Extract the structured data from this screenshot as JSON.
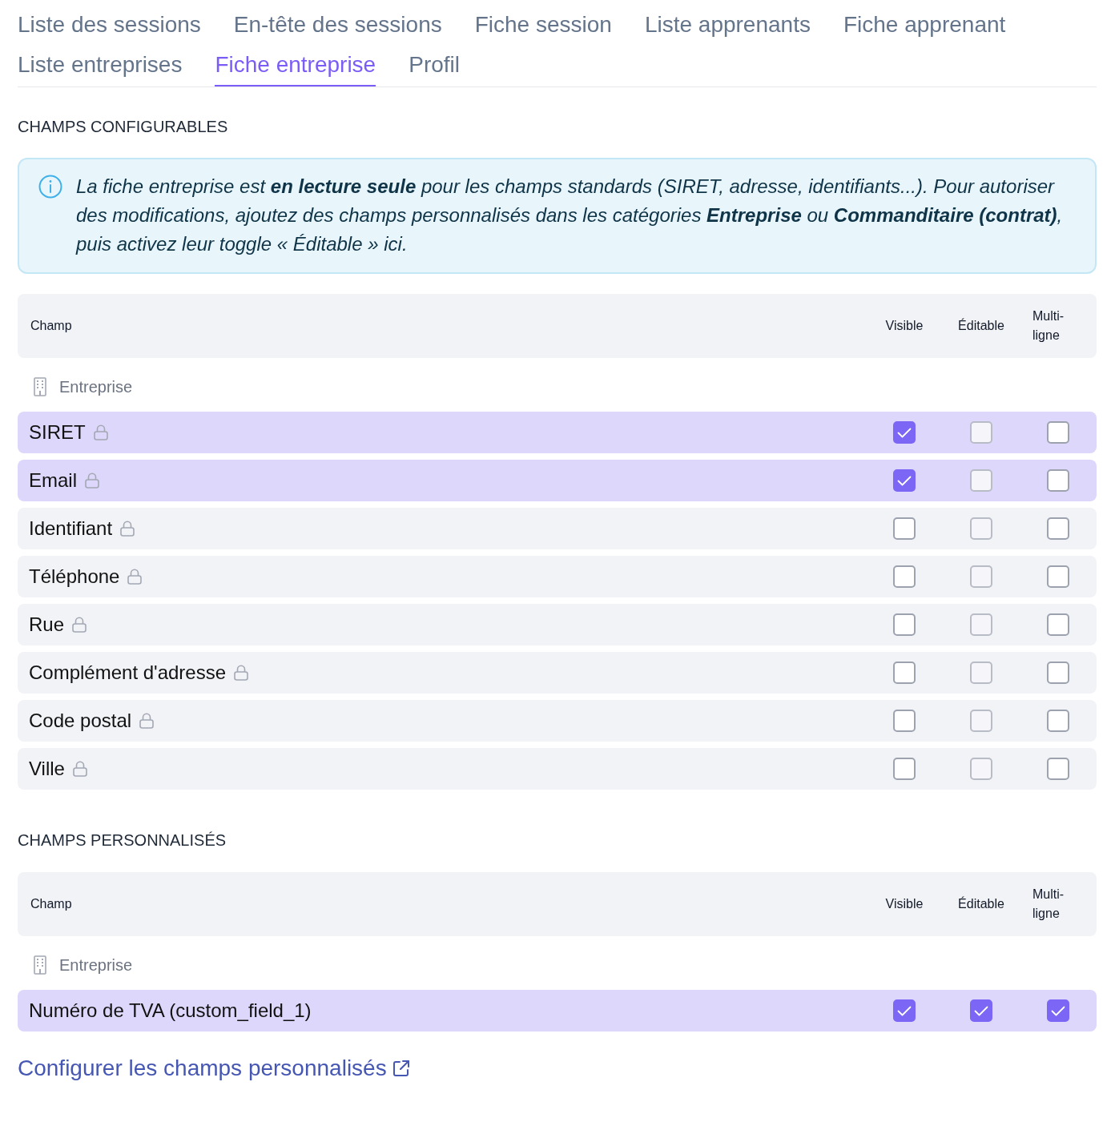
{
  "tabs": [
    {
      "label": "Liste des sessions",
      "selected": false
    },
    {
      "label": "En-tête des sessions",
      "selected": false
    },
    {
      "label": "Fiche session",
      "selected": false
    },
    {
      "label": "Liste apprenants",
      "selected": false
    },
    {
      "label": "Fiche apprenant",
      "selected": false
    },
    {
      "label": "Liste entreprises",
      "selected": false
    },
    {
      "label": "Fiche entreprise",
      "selected": true
    },
    {
      "label": "Profil",
      "selected": false
    }
  ],
  "sections": [
    {
      "title": "CHAMPS CONFIGURABLES",
      "notice": {
        "text": "La fiche entreprise est **en lecture seule** pour les champs standards (SIRET, adresse, identifiants...). Pour autoriser des modifications, ajoutez des champs personnalisés dans les catégories **Entreprise** ou **Commanditaire (contrat)**, puis activez leur toggle « Éditable » ici."
      },
      "table": {
        "columns": [
          "Champ",
          "Visible",
          "Éditable",
          "Multi-ligne"
        ],
        "groups": [
          {
            "label": "Entreprise",
            "rows": [
              {
                "label": "SIRET",
                "locked": true,
                "selected": true,
                "checks": [
                  {
                    "checked": true,
                    "disabled": false
                  },
                  {
                    "checked": false,
                    "disabled": true
                  },
                  {
                    "checked": false,
                    "disabled": false
                  }
                ]
              },
              {
                "label": "Email",
                "locked": true,
                "selected": true,
                "checks": [
                  {
                    "checked": true,
                    "disabled": false
                  },
                  {
                    "checked": false,
                    "disabled": true
                  },
                  {
                    "checked": false,
                    "disabled": false
                  }
                ]
              },
              {
                "label": "Identifiant",
                "locked": true,
                "selected": false,
                "checks": [
                  {
                    "checked": false,
                    "disabled": false
                  },
                  {
                    "checked": false,
                    "disabled": true
                  },
                  {
                    "checked": false,
                    "disabled": false
                  }
                ]
              },
              {
                "label": "Téléphone",
                "locked": true,
                "selected": false,
                "checks": [
                  {
                    "checked": false,
                    "disabled": false
                  },
                  {
                    "checked": false,
                    "disabled": true
                  },
                  {
                    "checked": false,
                    "disabled": false
                  }
                ]
              },
              {
                "label": "Rue",
                "locked": true,
                "selected": false,
                "checks": [
                  {
                    "checked": false,
                    "disabled": false
                  },
                  {
                    "checked": false,
                    "disabled": true
                  },
                  {
                    "checked": false,
                    "disabled": false
                  }
                ]
              },
              {
                "label": "Complément d'adresse",
                "locked": true,
                "selected": false,
                "checks": [
                  {
                    "checked": false,
                    "disabled": false
                  },
                  {
                    "checked": false,
                    "disabled": true
                  },
                  {
                    "checked": false,
                    "disabled": false
                  }
                ]
              },
              {
                "label": "Code postal",
                "locked": true,
                "selected": false,
                "checks": [
                  {
                    "checked": false,
                    "disabled": false
                  },
                  {
                    "checked": false,
                    "disabled": true
                  },
                  {
                    "checked": false,
                    "disabled": false
                  }
                ]
              },
              {
                "label": "Ville",
                "locked": true,
                "selected": false,
                "checks": [
                  {
                    "checked": false,
                    "disabled": false
                  },
                  {
                    "checked": false,
                    "disabled": true
                  },
                  {
                    "checked": false,
                    "disabled": false
                  }
                ]
              }
            ]
          }
        ]
      }
    },
    {
      "title": "CHAMPS PERSONNALISÉS",
      "table": {
        "columns": [
          "Champ",
          "Visible",
          "Éditable",
          "Multi-ligne"
        ],
        "groups": [
          {
            "label": "Entreprise",
            "rows": [
              {
                "label": "Numéro de TVA (custom_field_1)",
                "locked": false,
                "selected": true,
                "checks": [
                  {
                    "checked": true,
                    "disabled": false
                  },
                  {
                    "checked": true,
                    "disabled": false
                  },
                  {
                    "checked": true,
                    "disabled": false
                  }
                ]
              }
            ]
          }
        ]
      }
    }
  ],
  "link": {
    "label": "Configurer les champs personnalisés"
  }
}
